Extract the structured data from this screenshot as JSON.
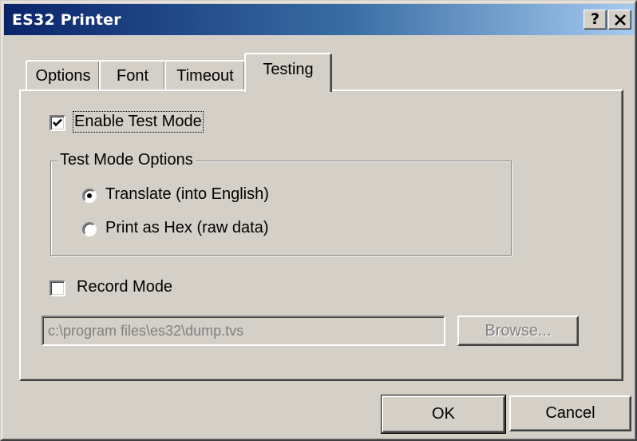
{
  "window": {
    "title": "ES32 Printer",
    "help_label": "?",
    "close_label": "✕"
  },
  "tabs": [
    {
      "label": "Options",
      "active": false
    },
    {
      "label": "Font",
      "active": false
    },
    {
      "label": "Timeout",
      "active": false
    },
    {
      "label": "Testing",
      "active": true
    }
  ],
  "testing": {
    "enable_test_mode": {
      "label": "Enable Test Mode",
      "checked": true
    },
    "test_mode_options": {
      "title": "Test Mode Options",
      "options": [
        {
          "label": "Translate (into English)",
          "selected": true
        },
        {
          "label": "Print as Hex (raw data)",
          "selected": false
        }
      ]
    },
    "record_mode": {
      "label": "Record Mode",
      "checked": false
    },
    "dump_path": {
      "value": "c:\\program files\\es32\\dump.tvs",
      "enabled": false
    },
    "browse_label": "Browse..."
  },
  "buttons": {
    "ok_label": "OK",
    "cancel_label": "Cancel"
  },
  "colors": {
    "face": "#d4d0c8",
    "title_start": "#0a246a",
    "title_end": "#a6caf0",
    "disabled_text": "#808080"
  }
}
